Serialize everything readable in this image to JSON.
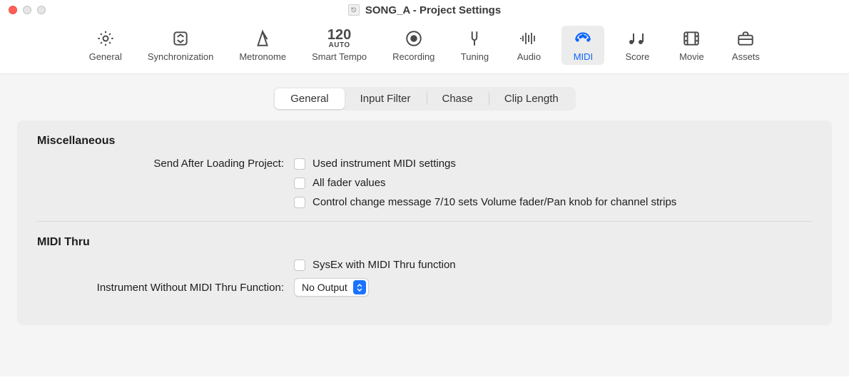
{
  "window": {
    "title": "SONG_A - Project Settings"
  },
  "toolbar": {
    "items": [
      {
        "id": "general",
        "label": "General"
      },
      {
        "id": "sync",
        "label": "Synchronization"
      },
      {
        "id": "metronome",
        "label": "Metronome"
      },
      {
        "id": "smarttempo",
        "label": "Smart Tempo",
        "tempo": "120",
        "auto": "AUTO"
      },
      {
        "id": "recording",
        "label": "Recording"
      },
      {
        "id": "tuning",
        "label": "Tuning"
      },
      {
        "id": "audio",
        "label": "Audio"
      },
      {
        "id": "midi",
        "label": "MIDI",
        "active": true
      },
      {
        "id": "score",
        "label": "Score"
      },
      {
        "id": "movie",
        "label": "Movie"
      },
      {
        "id": "assets",
        "label": "Assets"
      }
    ]
  },
  "subtabs": {
    "items": [
      {
        "label": "General",
        "active": true
      },
      {
        "label": "Input Filter"
      },
      {
        "label": "Chase"
      },
      {
        "label": "Clip Length"
      }
    ]
  },
  "sections": {
    "misc": {
      "title": "Miscellaneous",
      "sendAfterLabel": "Send After Loading Project:",
      "checks": [
        "Used instrument MIDI settings",
        "All fader values",
        "Control change message 7/10 sets Volume fader/Pan knob for channel strips"
      ]
    },
    "midiThru": {
      "title": "MIDI Thru",
      "sysexLabel": "SysEx with MIDI Thru function",
      "instrumentWithoutLabel": "Instrument Without MIDI Thru Function:",
      "selectValue": "No Output"
    }
  }
}
